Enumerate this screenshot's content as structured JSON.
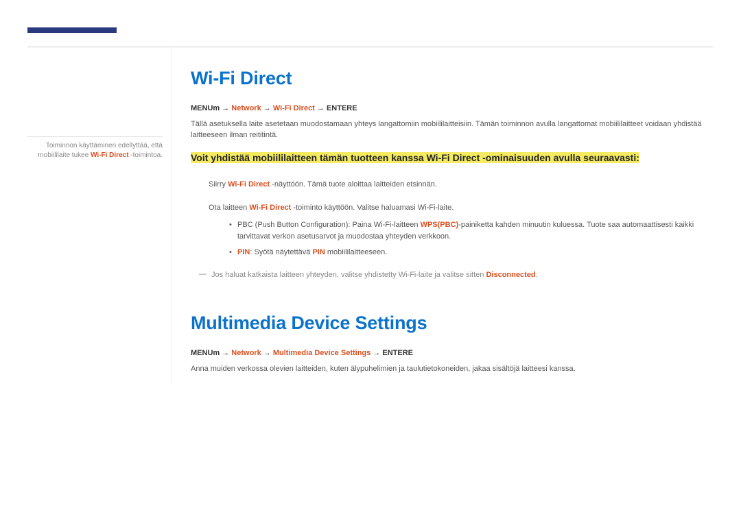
{
  "sidebar": {
    "note_line1": "Toiminnon käyttäminen edellyttää, että",
    "note_line2a": "mobiililaite tukee ",
    "note_brand": "Wi-Fi Direct",
    "note_line2b": " -toimintoa."
  },
  "section1": {
    "title": "Wi-Fi Direct",
    "menu_prefix": "MENU",
    "menu_icon": "m",
    "menu_network": "Network",
    "menu_item": "Wi-Fi Direct",
    "menu_enter": "ENTER",
    "menu_enter_icon": "E",
    "intro": "Tällä asetuksella laite asetetaan muodostamaan yhteys langattomiin mobiililaitteisiin. Tämän toiminnon avulla langattomat mobiililaitteet voidaan yhdistää laitteeseen ilman reititintä.",
    "highlight": "Voit yhdistää mobiililaitteen tämän tuotteen kanssa Wi-Fi Direct -ominaisuuden avulla seuraavasti:",
    "step1_a": "Siirry ",
    "step1_brand": "Wi-Fi Direct",
    "step1_b": " -näyttöön. Tämä tuote aloittaa laitteiden etsinnän.",
    "step2_a": "Ota laitteen ",
    "step2_brand": "Wi-Fi Direct",
    "step2_b": " -toiminto käyttöön. Valitse haluamasi Wi-Fi-laite.",
    "bullet1_a": "PBC (Push Button Configuration): Paina Wi-Fi-laitteen ",
    "bullet1_brand": "WPS(PBC)",
    "bullet1_b": "-painiketta kahden minuutin kuluessa. Tuote saa automaattisesti kaikki tarvittavat verkon asetusarvot ja muodostaa yhteyden verkkoon.",
    "bullet2_pin": "PIN",
    "bullet2_a": ": Syötä näytettävä ",
    "bullet2_pin2": "PIN",
    "bullet2_b": " mobiililaitteeseen.",
    "footnote_a": "Jos haluat katkaista laitteen yhteyden, valitse yhdistetty Wi-Fi-laite ja valitse sitten ",
    "footnote_brand": "Disconnected",
    "footnote_b": "."
  },
  "section2": {
    "title": "Multimedia Device Settings",
    "menu_prefix": "MENU",
    "menu_icon": "m",
    "menu_network": "Network",
    "menu_item": "Multimedia Device Settings",
    "menu_enter": "ENTER",
    "menu_enter_icon": "E",
    "intro": "Anna muiden verkossa olevien laitteiden, kuten älypuhelimien ja taulutietokoneiden, jakaa sisältöjä laitteesi kanssa."
  }
}
